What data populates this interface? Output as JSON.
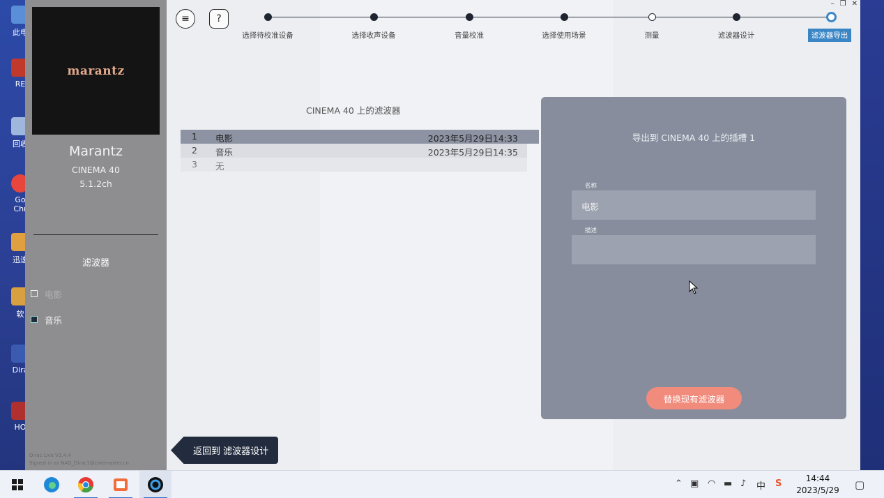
{
  "desktop": {
    "icons": [
      {
        "label": "此电"
      },
      {
        "label": "RE"
      },
      {
        "label": "回收"
      },
      {
        "label": "Go Chr"
      },
      {
        "label": "迅速"
      },
      {
        "label": "软"
      },
      {
        "label": "Dira"
      },
      {
        "label": "HO"
      }
    ]
  },
  "sidebar": {
    "logo_text": "marantz",
    "brand": "Marantz",
    "model": "CINEMA 40",
    "channels": "5.1.2ch",
    "section_title": "滤波器",
    "filters": [
      {
        "label": "电影",
        "checked": false
      },
      {
        "label": "音乐",
        "checked": true
      }
    ],
    "version_line1": "Dirac Live V3.4.4",
    "version_line2": "Signed in as NAD_Dirac1@cinemaster.cn"
  },
  "header": {
    "menu_icon": "≡",
    "help_icon": "?",
    "steps": [
      {
        "label": "选择待校准设备",
        "state": "done"
      },
      {
        "label": "选择收声设备",
        "state": "done"
      },
      {
        "label": "音量校准",
        "state": "done"
      },
      {
        "label": "选择使用场景",
        "state": "done"
      },
      {
        "label": "测量",
        "state": "hollow"
      },
      {
        "label": "滤波器设计",
        "state": "done"
      },
      {
        "label": "滤波器导出",
        "state": "active"
      }
    ],
    "window_controls": {
      "minimize": "–",
      "restore": "❐",
      "close": "✕"
    }
  },
  "filter_list": {
    "title": "CINEMA 40 上的滤波器",
    "rows": [
      {
        "num": "1",
        "name": "电影",
        "date": "2023年5月29日14:33"
      },
      {
        "num": "2",
        "name": "音乐",
        "date": "2023年5月29日14:35"
      },
      {
        "num": "3",
        "name": "无",
        "date": ""
      }
    ]
  },
  "export_panel": {
    "title": "导出到 CINEMA 40 上的插槽 1",
    "name_label": "名称",
    "name_value": "电影",
    "desc_label": "描述",
    "desc_value": "",
    "replace_button": "替换现有滤波器"
  },
  "footer": {
    "back_button": "返回到 滤波器设计"
  },
  "taskbar": {
    "time": "14:44",
    "date": "2023/5/29",
    "ime": "中",
    "apps": [
      "windows-start",
      "edge",
      "chrome",
      "pointer-app",
      "dirac-live"
    ]
  }
}
